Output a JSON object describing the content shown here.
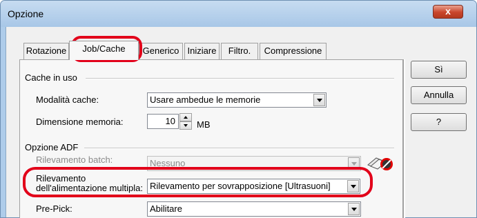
{
  "window": {
    "title": "Opzione",
    "close_glyph": "x",
    "close_icon": "close-icon"
  },
  "tabs": [
    "Rotazione",
    "Job/Cache",
    "Generico",
    "Iniziare",
    "Filtro.",
    "Compressione"
  ],
  "active_tab": "Job/Cache",
  "cache": {
    "group_label": "Cache in uso",
    "mode_label": "Modalità cache:",
    "mode_value": "Usare ambedue le memorie",
    "size_label": "Dimensione memoria:",
    "size_value": "10",
    "size_unit": "MB"
  },
  "adf": {
    "group_label": "Opzione ADF",
    "batch_label": "Rilevamento batch:",
    "batch_value": "Nessuno",
    "multifeed_label_1": "Rilevamento",
    "multifeed_label_2": "dell'alimentazione multipla:",
    "multifeed_value": "Rilevamento per sovrapposizione [Ultrasuoni]",
    "prepick_label": "Pre-Pick:",
    "prepick_value": "Abilitare",
    "icon": "no-paper-feed-icon"
  },
  "buttons": {
    "ok": "Sì",
    "cancel": "Annulla",
    "help": "?"
  },
  "colors": {
    "highlight": "#e2001a",
    "title_bar": "#aeccea",
    "close_button": "#c9452b"
  }
}
